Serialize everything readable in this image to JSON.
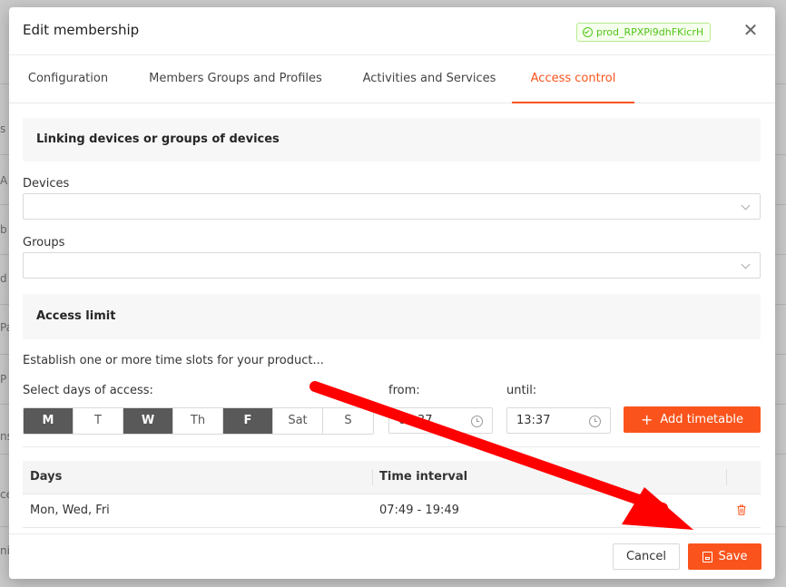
{
  "background": {
    "letters": [
      "s",
      "A",
      "b",
      "d",
      "Pa",
      "P",
      "ns",
      "ce",
      "ni"
    ]
  },
  "modal": {
    "title": "Edit membership",
    "product_id": "prod_RPXPi9dhFKicrH",
    "close_icon": "close-icon"
  },
  "tabs": [
    {
      "label": "Configuration",
      "active": false
    },
    {
      "label": "Members Groups and Profiles",
      "active": false
    },
    {
      "label": "Activities and Services",
      "active": false
    },
    {
      "label": "Access control",
      "active": true
    }
  ],
  "linking": {
    "section_title": "Linking devices or groups of devices",
    "devices_label": "Devices",
    "devices_value": "",
    "groups_label": "Groups",
    "groups_value": ""
  },
  "access_limit": {
    "section_title": "Access limit",
    "hint": "Establish one or more time slots for your product...",
    "days_label": "Select days of access:",
    "days": [
      {
        "label": "M",
        "selected": true
      },
      {
        "label": "T",
        "selected": false
      },
      {
        "label": "W",
        "selected": true
      },
      {
        "label": "Th",
        "selected": false
      },
      {
        "label": "F",
        "selected": true
      },
      {
        "label": "Sat",
        "selected": false
      },
      {
        "label": "S",
        "selected": false
      }
    ],
    "from_label": "from:",
    "from_value": "07:37",
    "until_label": "until:",
    "until_value": "13:37",
    "add_button": "Add timetable"
  },
  "table": {
    "headers": [
      "Days",
      "Time interval"
    ],
    "rows": [
      {
        "days": "Mon, Wed, Fri",
        "interval": "07:49 - 19:49"
      }
    ]
  },
  "footer": {
    "cancel": "Cancel",
    "save": "Save"
  },
  "colors": {
    "accent": "#fa541c",
    "success": "#52c41a",
    "annotation_arrow": "#ff0000"
  }
}
